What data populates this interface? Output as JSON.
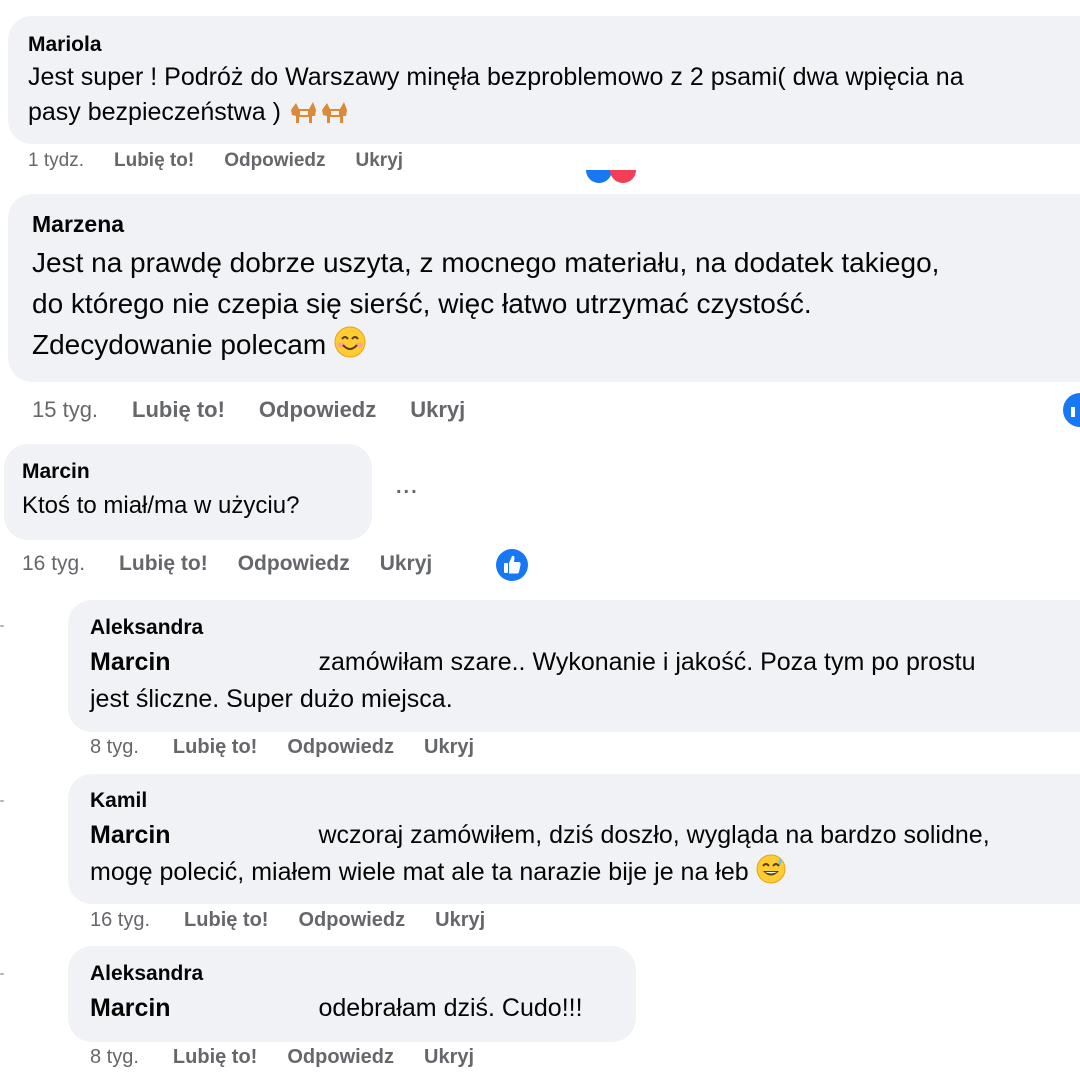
{
  "comments": [
    {
      "author": "Mariola",
      "line1": "Jest super ! Podróż do Warszawy minęła bezproblemowo z 2 psami( dwa wpięcia na",
      "line2": "pasy bezpieczeństwa )",
      "emoji": "dog-icon",
      "actions": {
        "time": "1 tydz.",
        "like": "Lubię to!",
        "reply": "Odpowiedz",
        "hide": "Ukryj"
      }
    },
    {
      "author": "Marzena",
      "line1": "Jest na prawdę dobrze uszyta, z mocnego materiału, na dodatek takiego,",
      "line2": "do którego nie czepia się sierść, więc łatwo utrzymać czystość.",
      "line3": "Zdecydowanie polecam",
      "emoji": "smile-emoji-icon",
      "actions": {
        "time": "15 tyg.",
        "like": "Lubię to!",
        "reply": "Odpowiedz",
        "hide": "Ukryj"
      }
    },
    {
      "author": "Marcin",
      "line1": "Ktoś to miał/ma w użyciu?",
      "more": "...",
      "actions": {
        "time": "16 tyg.",
        "like": "Lubię to!",
        "reply": "Odpowiedz",
        "hide": "Ukryj"
      }
    }
  ],
  "replies": [
    {
      "author": "Aleksandra",
      "tag": "Marcin",
      "line1": "zamówiłam szare.. Wykonanie i jakość. Poza tym po prostu",
      "line2": "jest śliczne. Super dużo miejsca.",
      "actions": {
        "time": "8 tyg.",
        "like": "Lubię to!",
        "reply": "Odpowiedz",
        "hide": "Ukryj"
      }
    },
    {
      "author": "Kamil",
      "tag": "Marcin",
      "line1": "wczoraj zamówiłem, dziś doszło, wygląda na bardzo solidne,",
      "line2": "mogę polecić, miałem wiele mat ale ta narazie bije je na łeb",
      "emoji": "sweat-smile-emoji-icon",
      "actions": {
        "time": "16 tyg.",
        "like": "Lubię to!",
        "reply": "Odpowiedz",
        "hide": "Ukryj"
      }
    },
    {
      "author": "Aleksandra",
      "tag": "Marcin",
      "line1": "odebrałam dziś. Cudo!!!",
      "actions": {
        "time": "8 tyg.",
        "like": "Lubię to!",
        "reply": "Odpowiedz",
        "hide": "Ukryj"
      }
    }
  ],
  "colors": {
    "bubble": "#f0f2f5",
    "meta": "#65676b",
    "like_blue": "#1877f2"
  }
}
